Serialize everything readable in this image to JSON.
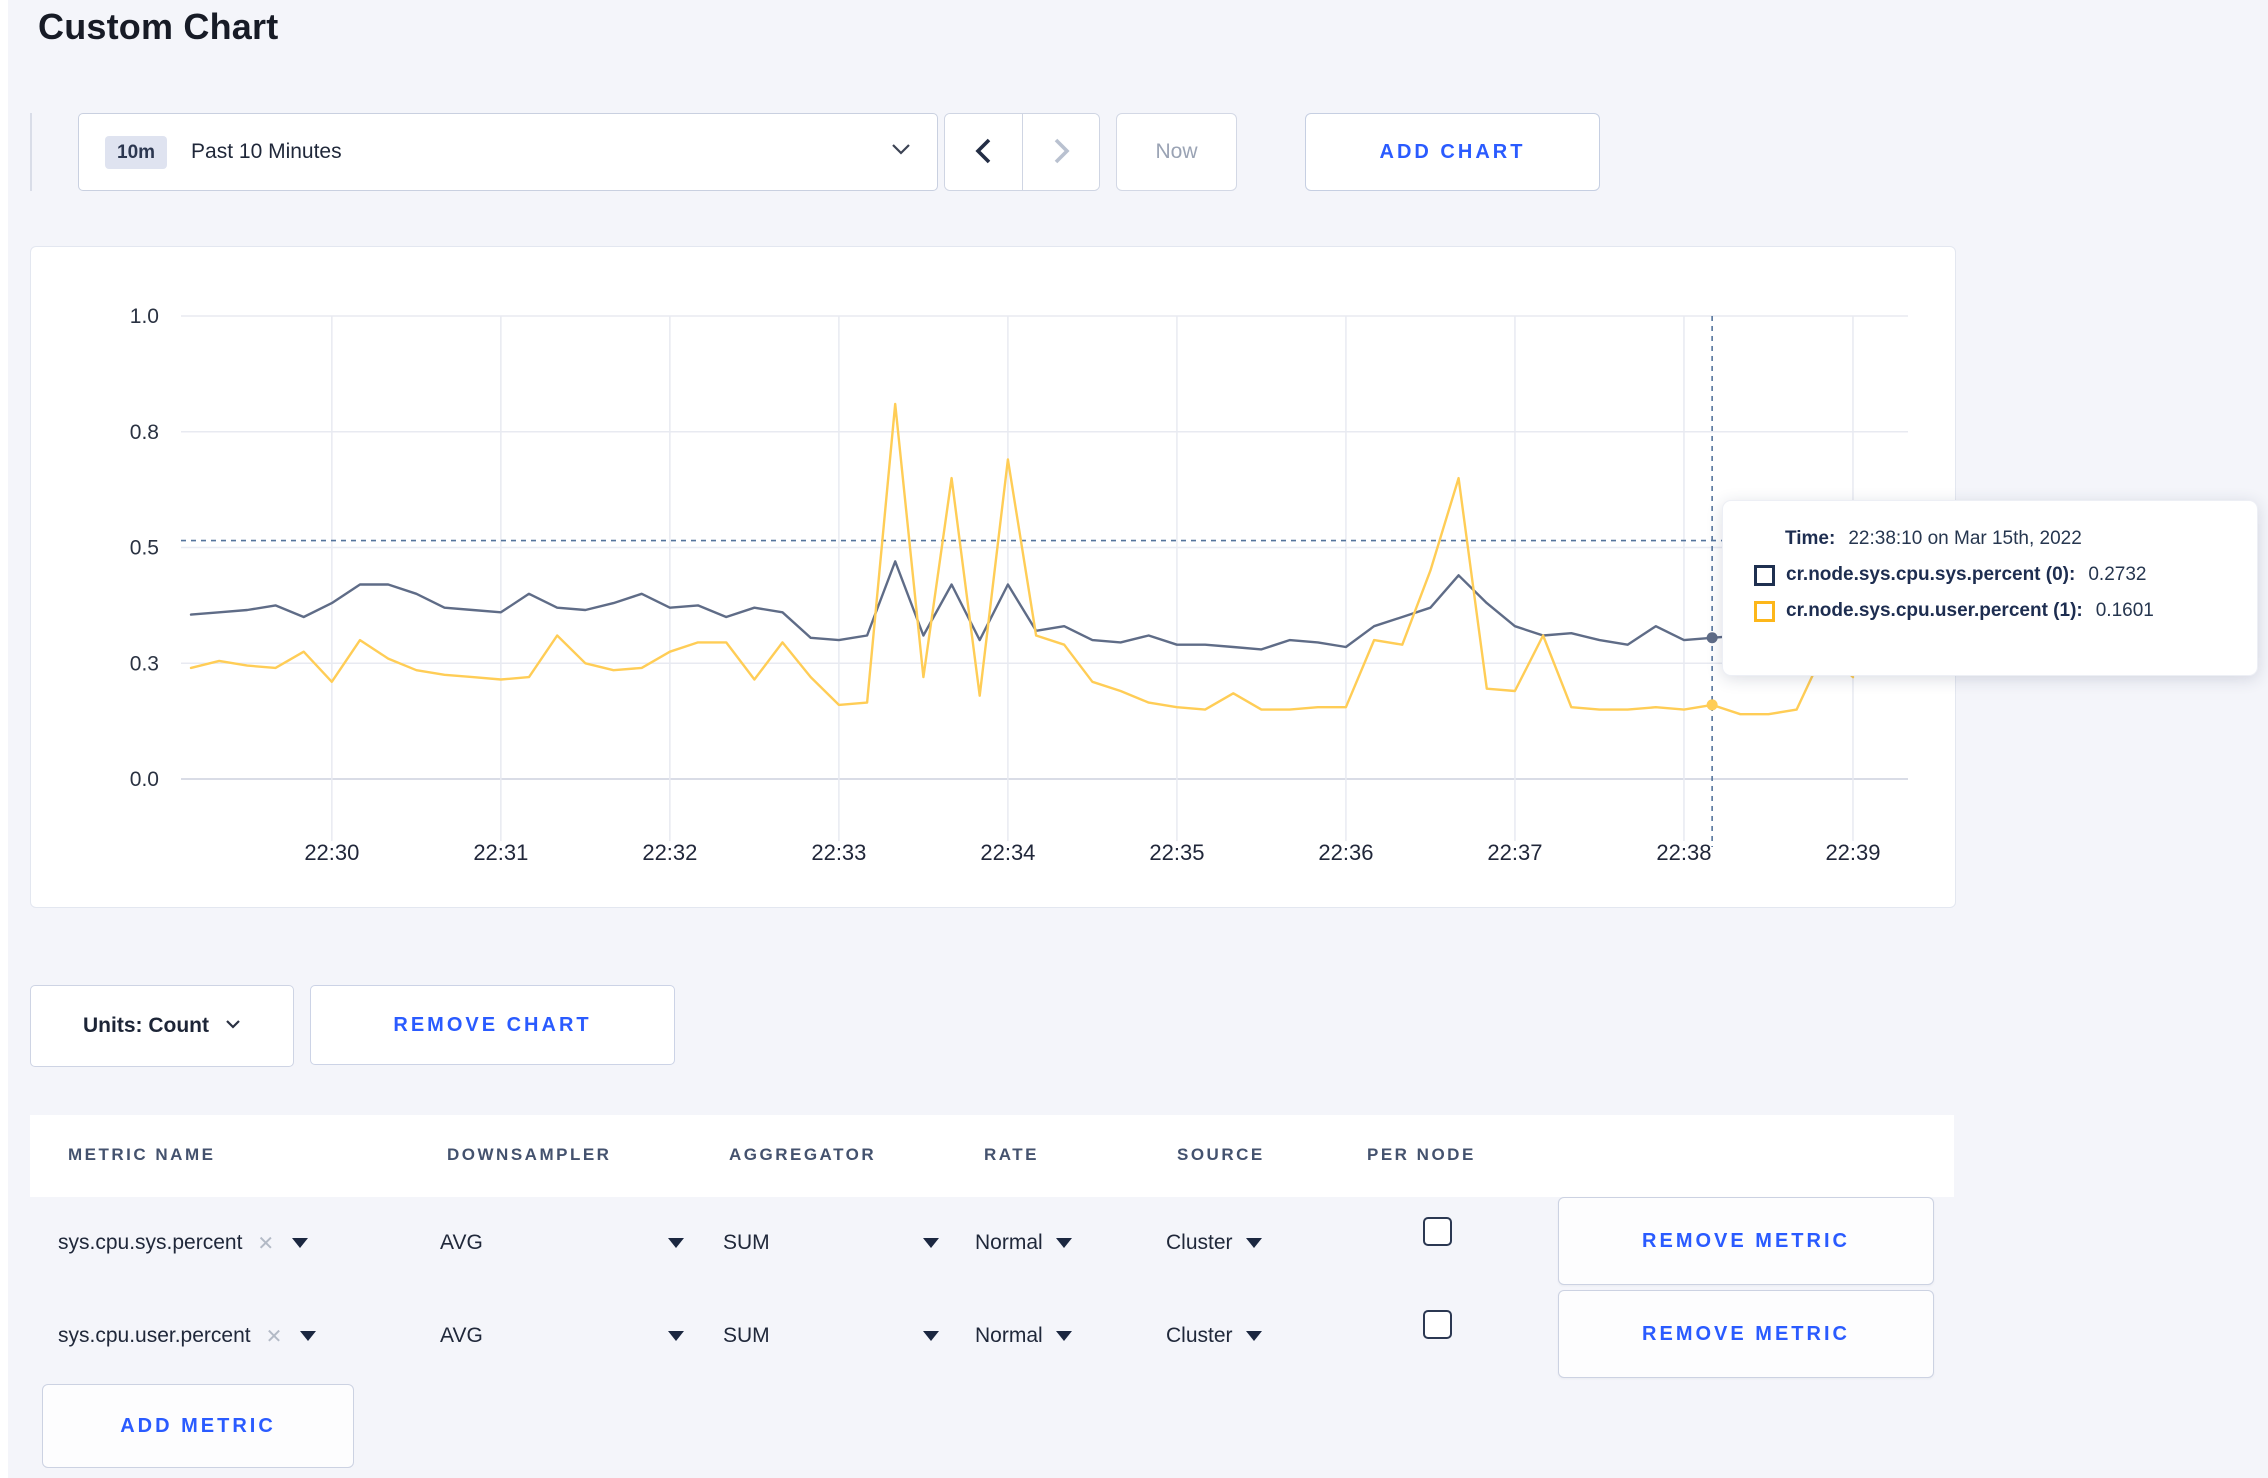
{
  "page": {
    "title": "Custom Chart"
  },
  "toolbar": {
    "range_badge": "10m",
    "range_label": "Past 10 Minutes",
    "now_label": "Now",
    "add_chart_label": "ADD CHART"
  },
  "chart_footer": {
    "units_label": "Units: Count",
    "remove_chart_label": "REMOVE CHART"
  },
  "tooltip": {
    "time_label": "Time:",
    "time_value": "22:38:10 on Mar 15th, 2022",
    "rows": [
      {
        "label": "cr.node.sys.cpu.sys.percent (0):",
        "value": "0.2732",
        "swatch_color": "#1f3050"
      },
      {
        "label": "cr.node.sys.cpu.user.percent (1):",
        "value": "0.1601",
        "swatch_color": "#fdb71a"
      }
    ]
  },
  "chart_data": {
    "type": "line",
    "title": "",
    "xlabel": "",
    "ylabel": "",
    "ylim": [
      0,
      1
    ],
    "y_tick_values": [
      0,
      0.25,
      0.5,
      0.75,
      1.0
    ],
    "y_tick_labels": [
      "0.0",
      "0.3",
      "0.5",
      "0.8",
      "1.0"
    ],
    "x_tick_labels": [
      "22:30",
      "22:31",
      "22:32",
      "22:33",
      "22:34",
      "22:35",
      "22:36",
      "22:37",
      "22:38",
      "22:39"
    ],
    "x_start": "22:29:10",
    "x_interval_sec": 10,
    "grid": true,
    "legend_position": "none",
    "crosshair": {
      "index": 54,
      "time": "22:38:10",
      "y_value": 0.515
    },
    "series": [
      {
        "name": "cr.node.sys.cpu.sys.percent",
        "color": "#5f6c87",
        "values": [
          0.355,
          0.36,
          0.365,
          0.375,
          0.35,
          0.38,
          0.42,
          0.42,
          0.4,
          0.37,
          0.365,
          0.36,
          0.4,
          0.37,
          0.365,
          0.38,
          0.4,
          0.37,
          0.375,
          0.35,
          0.37,
          0.36,
          0.305,
          0.3,
          0.31,
          0.47,
          0.31,
          0.42,
          0.3,
          0.42,
          0.32,
          0.33,
          0.3,
          0.295,
          0.31,
          0.29,
          0.29,
          0.285,
          0.28,
          0.3,
          0.295,
          0.285,
          0.33,
          0.35,
          0.37,
          0.44,
          0.38,
          0.33,
          0.31,
          0.315,
          0.3,
          0.29,
          0.33,
          0.3,
          0.305,
          0.31,
          0.3,
          0.3,
          0.305,
          0.3
        ]
      },
      {
        "name": "cr.node.sys.cpu.user.percent",
        "color": "#ffcd56",
        "values": [
          0.24,
          0.255,
          0.245,
          0.24,
          0.275,
          0.21,
          0.3,
          0.26,
          0.235,
          0.225,
          0.22,
          0.215,
          0.22,
          0.31,
          0.25,
          0.235,
          0.24,
          0.275,
          0.295,
          0.295,
          0.215,
          0.295,
          0.22,
          0.16,
          0.165,
          0.81,
          0.22,
          0.65,
          0.18,
          0.69,
          0.31,
          0.29,
          0.21,
          0.19,
          0.165,
          0.155,
          0.15,
          0.185,
          0.15,
          0.15,
          0.155,
          0.155,
          0.3,
          0.29,
          0.45,
          0.65,
          0.195,
          0.19,
          0.31,
          0.155,
          0.15,
          0.15,
          0.155,
          0.15,
          0.16,
          0.14,
          0.14,
          0.15,
          0.28,
          0.22
        ]
      }
    ]
  },
  "metrics_table": {
    "headers": [
      "METRIC NAME",
      "DOWNSAMPLER",
      "AGGREGATOR",
      "RATE",
      "SOURCE",
      "PER NODE"
    ],
    "rows": [
      {
        "metric": "sys.cpu.sys.percent",
        "downsampler": "AVG",
        "aggregator": "SUM",
        "rate": "Normal",
        "source": "Cluster",
        "per_node_checked": false,
        "remove_label": "REMOVE METRIC"
      },
      {
        "metric": "sys.cpu.user.percent",
        "downsampler": "AVG",
        "aggregator": "SUM",
        "rate": "Normal",
        "source": "Cluster",
        "per_node_checked": false,
        "remove_label": "REMOVE METRIC"
      }
    ],
    "add_metric_label": "ADD METRIC"
  }
}
